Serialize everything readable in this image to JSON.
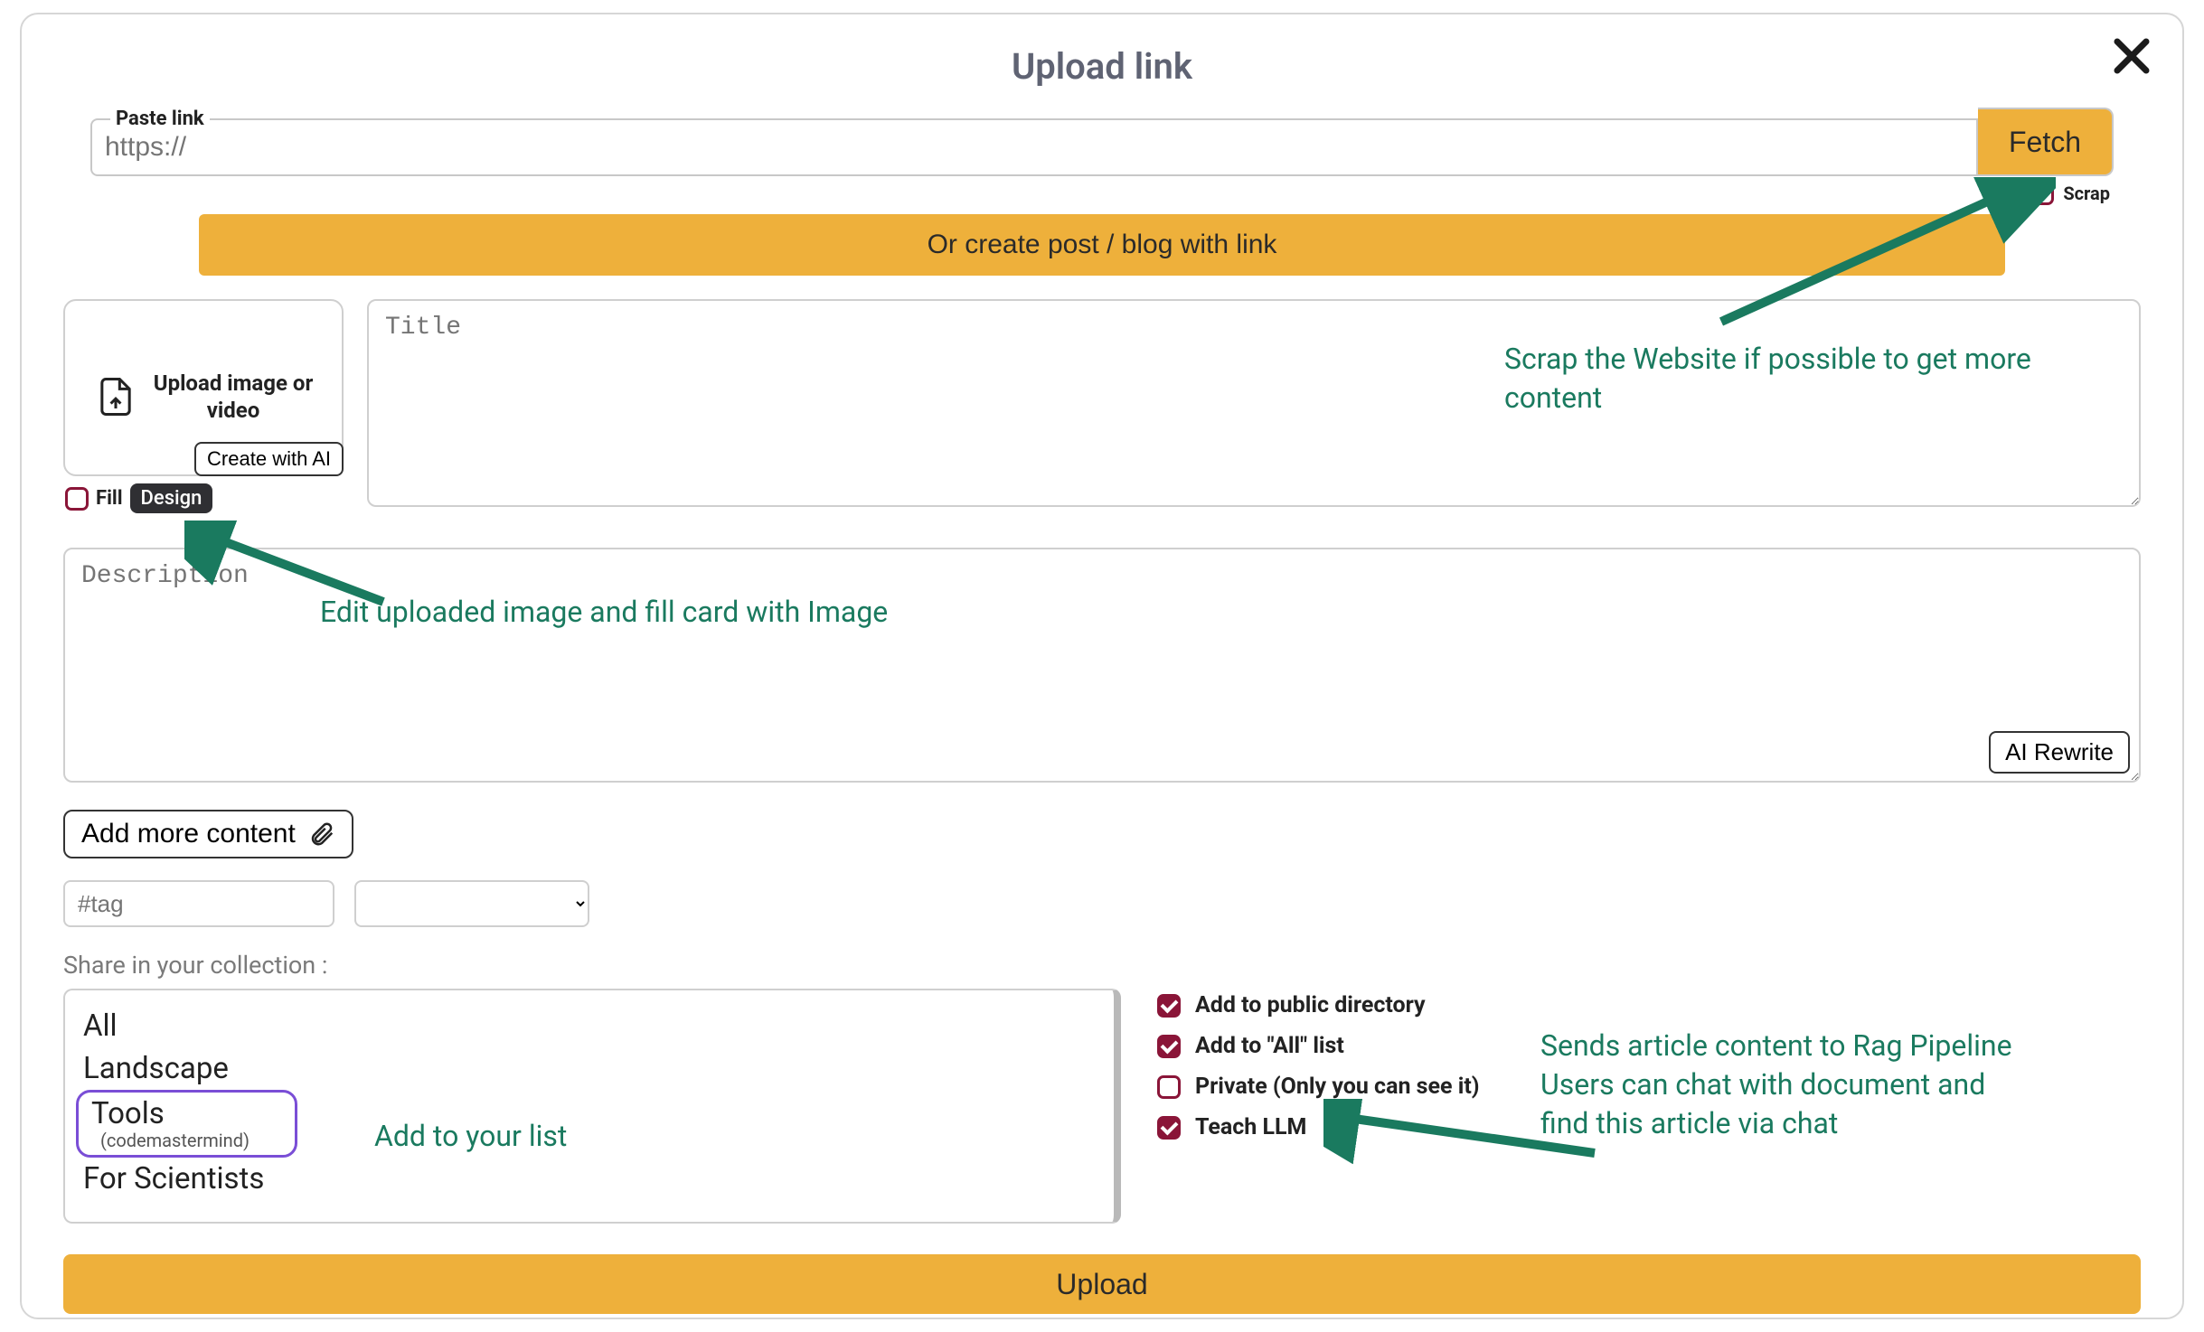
{
  "header": {
    "title": "Upload link"
  },
  "link": {
    "legend": "Paste link",
    "placeholder": "https://",
    "fetch_label": "Fetch",
    "scrap_label": "Scrap"
  },
  "create_post_label": "Or create post / blog with link",
  "upload_card": {
    "text": "Upload image or video",
    "create_ai_label": "Create with AI",
    "fill_label": "Fill",
    "design_label": "Design"
  },
  "title": {
    "placeholder": "Title"
  },
  "description": {
    "placeholder": "Description",
    "ai_rewrite_label": "AI Rewrite"
  },
  "add_more_label": "Add more content",
  "tags": {
    "placeholder": "#tag"
  },
  "share_label": "Share in your collection :",
  "collections": [
    {
      "name": "All"
    },
    {
      "name": "Landscape"
    },
    {
      "name": "Tools",
      "sub": "(codemastermind)",
      "highlighted": true
    },
    {
      "name": "For Scientists"
    }
  ],
  "options": {
    "public_directory": {
      "label": "Add to public directory",
      "checked": true
    },
    "add_all": {
      "label": "Add to \"All\" list",
      "checked": true
    },
    "private": {
      "label": "Private (Only you can see it)",
      "checked": false
    },
    "teach_llm": {
      "label": "Teach LLM",
      "checked": true
    }
  },
  "upload_btn_label": "Upload",
  "annotations": {
    "scrap": "Scrap the Website if possible to get more content",
    "fill": "Edit uploaded image and fill card with Image",
    "list": "Add to your list",
    "teach": "Sends article content to Rag Pipeline\nUsers can chat with document and\nfind this article via chat"
  }
}
